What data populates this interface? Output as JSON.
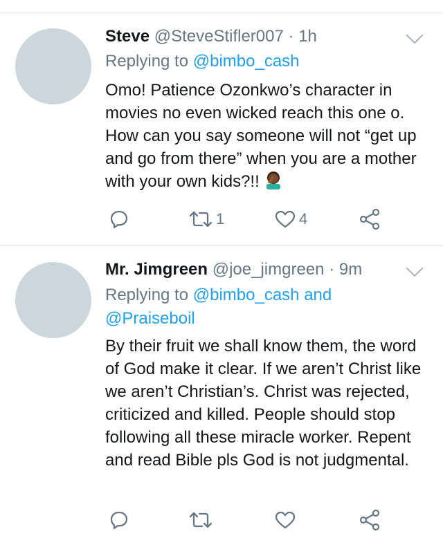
{
  "tweets": [
    {
      "name": "Steve",
      "handle": "@SteveStifler007",
      "separator": "·",
      "time": "1h",
      "replying_prefix": "Replying to",
      "replying_to": "@bimbo_cash",
      "body": "Omo! Patience Ozonkwo’s character in movies no even wicked reach this one o. How can you say someone will not “get up and go from there” when you are a mother with your own kids?!!",
      "emoji": "face-palm-emoji",
      "reply_count": "",
      "retweet_count": "1",
      "like_count": "4"
    },
    {
      "name": "Mr. Jimgreen",
      "handle": "@joe_jimgreen",
      "separator": "·",
      "time": "9m",
      "replying_prefix": "Replying to",
      "replying_to": "@bimbo_cash and",
      "replying_to_2": "@Praiseboil",
      "body": "By their fruit we shall know them, the word of God make it clear. If we aren’t Christ like we aren’t Christian’s. Christ was rejected, criticized and killed. People should stop following all these miracle worker. Repent and read Bible pls God is not judgmental.",
      "reply_count": "",
      "retweet_count": "",
      "like_count": ""
    }
  ],
  "icons": {
    "reply": "reply-icon",
    "retweet": "retweet-icon",
    "like": "heart-icon",
    "share": "share-icon",
    "menu": "chevron-down-icon"
  },
  "colors": {
    "link": "#1da1f2",
    "muted": "#657786",
    "avatar_placeholder": "#ccd6dd",
    "divider": "#e1e8ed"
  }
}
